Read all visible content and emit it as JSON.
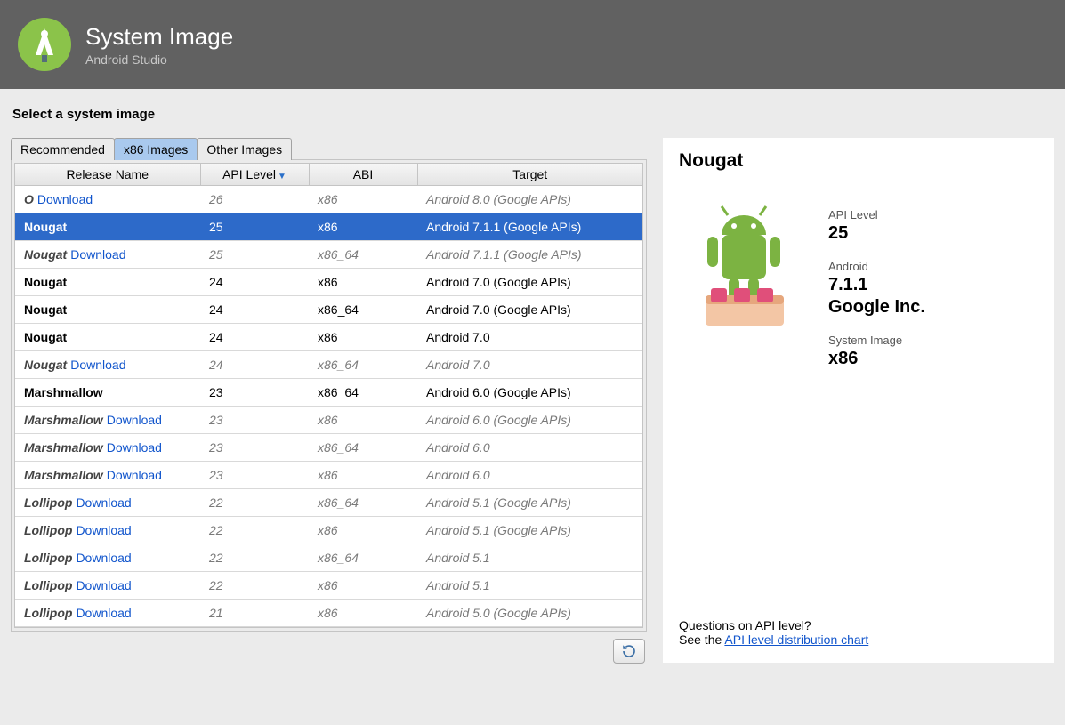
{
  "header": {
    "title": "System Image",
    "subtitle": "Android Studio"
  },
  "instruction": "Select a system image",
  "tabs": [
    {
      "label": "Recommended",
      "active": false
    },
    {
      "label": "x86 Images",
      "active": true
    },
    {
      "label": "Other Images",
      "active": false
    }
  ],
  "table": {
    "columns": [
      "Release Name",
      "API Level",
      "ABI",
      "Target"
    ],
    "sort_column_index": 1,
    "rows": [
      {
        "name": "O",
        "needs_download": true,
        "selected": false,
        "api": "26",
        "abi": "x86",
        "target": "Android 8.0 (Google APIs)"
      },
      {
        "name": "Nougat",
        "needs_download": false,
        "selected": true,
        "api": "25",
        "abi": "x86",
        "target": "Android 7.1.1 (Google APIs)"
      },
      {
        "name": "Nougat",
        "needs_download": true,
        "selected": false,
        "api": "25",
        "abi": "x86_64",
        "target": "Android 7.1.1 (Google APIs)"
      },
      {
        "name": "Nougat",
        "needs_download": false,
        "selected": false,
        "api": "24",
        "abi": "x86",
        "target": "Android 7.0 (Google APIs)"
      },
      {
        "name": "Nougat",
        "needs_download": false,
        "selected": false,
        "api": "24",
        "abi": "x86_64",
        "target": "Android 7.0 (Google APIs)"
      },
      {
        "name": "Nougat",
        "needs_download": false,
        "selected": false,
        "api": "24",
        "abi": "x86",
        "target": "Android 7.0"
      },
      {
        "name": "Nougat",
        "needs_download": true,
        "selected": false,
        "api": "24",
        "abi": "x86_64",
        "target": "Android 7.0"
      },
      {
        "name": "Marshmallow",
        "needs_download": false,
        "selected": false,
        "api": "23",
        "abi": "x86_64",
        "target": "Android 6.0 (Google APIs)"
      },
      {
        "name": "Marshmallow",
        "needs_download": true,
        "selected": false,
        "api": "23",
        "abi": "x86",
        "target": "Android 6.0 (Google APIs)"
      },
      {
        "name": "Marshmallow",
        "needs_download": true,
        "selected": false,
        "api": "23",
        "abi": "x86_64",
        "target": "Android 6.0"
      },
      {
        "name": "Marshmallow",
        "needs_download": true,
        "selected": false,
        "api": "23",
        "abi": "x86",
        "target": "Android 6.0"
      },
      {
        "name": "Lollipop",
        "needs_download": true,
        "selected": false,
        "api": "22",
        "abi": "x86_64",
        "target": "Android 5.1 (Google APIs)"
      },
      {
        "name": "Lollipop",
        "needs_download": true,
        "selected": false,
        "api": "22",
        "abi": "x86",
        "target": "Android 5.1 (Google APIs)"
      },
      {
        "name": "Lollipop",
        "needs_download": true,
        "selected": false,
        "api": "22",
        "abi": "x86_64",
        "target": "Android 5.1"
      },
      {
        "name": "Lollipop",
        "needs_download": true,
        "selected": false,
        "api": "22",
        "abi": "x86",
        "target": "Android 5.1"
      },
      {
        "name": "Lollipop",
        "needs_download": true,
        "selected": false,
        "api": "21",
        "abi": "x86",
        "target": "Android 5.0 (Google APIs)"
      }
    ],
    "download_label": "Download"
  },
  "detail": {
    "title": "Nougat",
    "api_label": "API Level",
    "api_value": "25",
    "android_label": "Android",
    "android_version": "7.1.1",
    "vendor": "Google Inc.",
    "sysimg_label": "System Image",
    "sysimg_value": "x86",
    "footer_q": "Questions on API level?",
    "footer_pre": "See the ",
    "footer_link": "API level distribution chart"
  }
}
